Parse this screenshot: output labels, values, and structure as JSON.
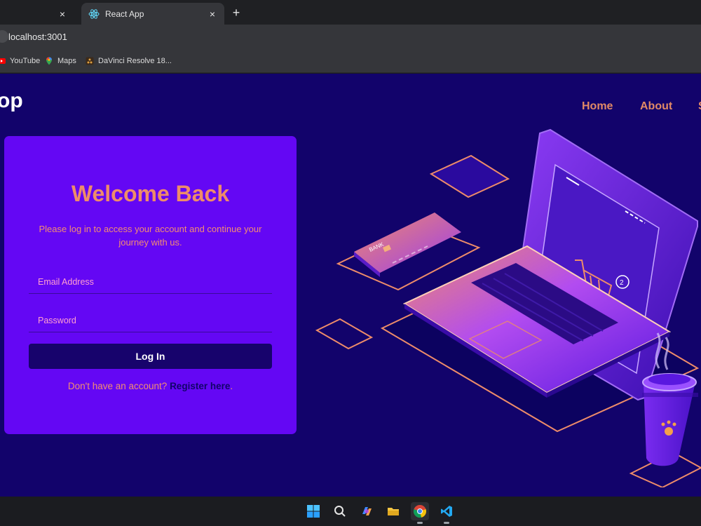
{
  "browser": {
    "tabs": [
      {
        "label": "",
        "close_icon": "×"
      },
      {
        "label": "React App",
        "close_icon": "×",
        "favicon": "react-icon"
      }
    ],
    "new_tab_icon": "+",
    "address": "localhost:3001",
    "bookmarks": [
      {
        "label": "YouTube",
        "icon": "youtube-icon"
      },
      {
        "label": "Maps",
        "icon": "maps-icon"
      },
      {
        "label": "DaVinci Resolve 18...",
        "icon": "davinci-icon"
      }
    ]
  },
  "header": {
    "brand": "op",
    "nav": [
      "Home",
      "About",
      "S"
    ]
  },
  "login": {
    "title": "Welcome Back",
    "subtitle": "Please log in to access your account and continue your journey with us.",
    "email_placeholder": "Email Address",
    "password_placeholder": "Password",
    "submit_label": "Log In",
    "register_prompt": "Don't have an account? ",
    "register_link": "Register here",
    "register_suffix": "."
  },
  "illustration": {
    "card_text": "BANK",
    "cart_badge": "2"
  },
  "taskbar": {
    "icons": [
      "windows-start-icon",
      "search-icon",
      "copilot-icon",
      "file-explorer-icon",
      "chrome-icon",
      "vscode-icon"
    ]
  },
  "colors": {
    "page_bg": "#12036b",
    "card_bg": "#6407f4",
    "accent": "#ee8c69",
    "button_bg": "#17036c"
  }
}
